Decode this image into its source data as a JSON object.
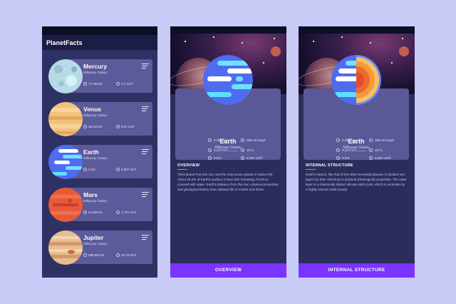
{
  "colors": {
    "background": "#c9cbf7",
    "panel": "#5c5a9a",
    "accent": "#7b34ff"
  },
  "list_screen": {
    "title": "PlanetFacts",
    "menu_icon": "menu-lines-icon",
    "planets": [
      {
        "name": "Mercury",
        "galaxy": "Milkyway Galaxy",
        "distance": "77.2M km",
        "gravity": "3.7 m/s²",
        "colors": [
          "#d9f0f7",
          "#9fc3d2"
        ]
      },
      {
        "name": "Venus",
        "galaxy": "Milkyway Galaxy",
        "distance": "38.2M km",
        "gravity": "8.87 m/s²",
        "colors": [
          "#f6d499",
          "#e2a95c"
        ]
      },
      {
        "name": "Earth",
        "galaxy": "Milkyway Galaxy",
        "distance": "0 km",
        "gravity": "9.807 m/s²",
        "colors": [
          "#4f6cf0",
          "#6fe2ff"
        ]
      },
      {
        "name": "Mars",
        "galaxy": "Milkyway Galaxy",
        "distance": "54.6M km",
        "gravity": "3.721 m/s²",
        "colors": [
          "#f0704b",
          "#d8482d"
        ]
      },
      {
        "name": "Jupiter",
        "galaxy": "Milkyway Galaxy",
        "distance": "588.5M km",
        "gravity": "24.79 m/s²",
        "colors": [
          "#f3d3b1",
          "#cf9a6c"
        ]
      }
    ]
  },
  "overview_screen": {
    "planet_name": "Earth",
    "galaxy": "Milkyway Galaxy",
    "stats": {
      "distance": "0 km",
      "gravity": "9.007 m/s²",
      "orbit": "0.99 Days",
      "year": "365.25 Days",
      "radius": "6,371 km",
      "temperature": "16°C"
    },
    "section_title": "OVERVIEW",
    "section_text": "Third planet from the Sun and the only known planet to harbor life. About 29.2% of Earth's surface is land with remaining 70.8% is covered with water. Earth's distance from the Sun, physical properties and geological history have allowed life to evolve and thrive.",
    "button_label": "OVERVIEW"
  },
  "structure_screen": {
    "planet_name": "Earth",
    "galaxy": "Milkyway Galaxy",
    "stats": {
      "distance": "0 km",
      "gravity": "9.807 m/s²",
      "orbit": "0.99 Days",
      "year": "365.25 Days",
      "radius": "6,371 km",
      "temperature": "16°C"
    },
    "section_title": "INTERNAL STRUCTURE",
    "section_text": "Earth's interior, like that of the other terrestrial planets, is divided into layers by their chemical or physical (rheological) properties. The outer layer is a chemically distinct silicate solid crust, which is underlain by a highly viscous solid mantle.",
    "button_label": "INTERNAL STRUCTURE"
  }
}
